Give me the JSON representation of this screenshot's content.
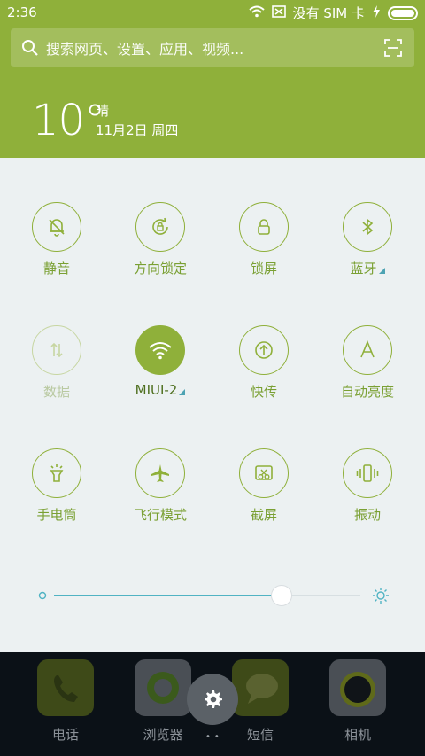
{
  "status": {
    "time": "2:36",
    "carrier": "没有 SIM 卡"
  },
  "search": {
    "placeholder": "搜索网页、设置、应用、视频..."
  },
  "weather": {
    "temperature": "10°",
    "condition": "晴",
    "date": "11月2日 周四"
  },
  "tiles": [
    {
      "label": "静音",
      "icon": "bell-off-icon",
      "state": "off"
    },
    {
      "label": "方向锁定",
      "icon": "rotation-lock-icon",
      "state": "off"
    },
    {
      "label": "锁屏",
      "icon": "lock-icon",
      "state": "off"
    },
    {
      "label": "蓝牙",
      "icon": "bluetooth-icon",
      "state": "off",
      "has_more": true
    },
    {
      "label": "数据",
      "icon": "data-arrows-icon",
      "state": "disabled"
    },
    {
      "label": "MIUI-2",
      "icon": "wifi-icon",
      "state": "on",
      "has_more": true
    },
    {
      "label": "快传",
      "icon": "upload-icon",
      "state": "off"
    },
    {
      "label": "自动亮度",
      "icon": "auto-brightness-icon",
      "state": "off"
    },
    {
      "label": "手电筒",
      "icon": "flashlight-icon",
      "state": "off"
    },
    {
      "label": "飞行模式",
      "icon": "airplane-icon",
      "state": "off"
    },
    {
      "label": "截屏",
      "icon": "screenshot-icon",
      "state": "off"
    },
    {
      "label": "振动",
      "icon": "vibrate-icon",
      "state": "off"
    }
  ],
  "brightness": {
    "level": 0.74
  },
  "dock": {
    "apps": [
      "电话",
      "浏览器",
      "短信",
      "相机"
    ]
  },
  "colors": {
    "accent": "#8fb03a",
    "slider": "#50b3c3",
    "panel": "#ecf1f2"
  }
}
